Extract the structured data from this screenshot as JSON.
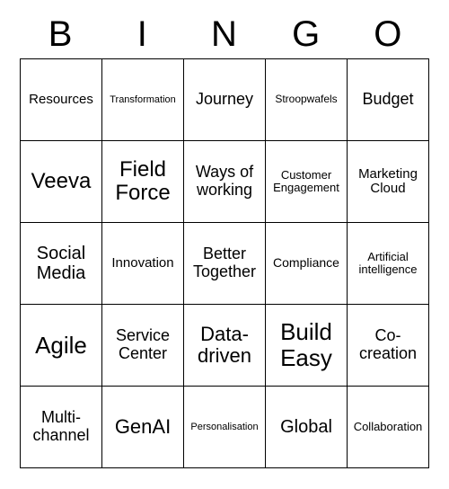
{
  "header": [
    "B",
    "I",
    "N",
    "G",
    "O"
  ],
  "cells": [
    {
      "text": "Resources",
      "size": "15px"
    },
    {
      "text": "Transformation",
      "size": "11px"
    },
    {
      "text": "Journey",
      "size": "18px"
    },
    {
      "text": "Stroopwafels",
      "size": "12px"
    },
    {
      "text": "Budget",
      "size": "18px"
    },
    {
      "text": "Veeva",
      "size": "24px"
    },
    {
      "text": "Field Force",
      "size": "24px"
    },
    {
      "text": "Ways of working",
      "size": "18px"
    },
    {
      "text": "Customer Engagement",
      "size": "13px"
    },
    {
      "text": "Marketing Cloud",
      "size": "15px"
    },
    {
      "text": "Social Media",
      "size": "20px"
    },
    {
      "text": "Innovation",
      "size": "15px"
    },
    {
      "text": "Better Together",
      "size": "18px"
    },
    {
      "text": "Compliance",
      "size": "14px"
    },
    {
      "text": "Artificial intelligence",
      "size": "13px"
    },
    {
      "text": "Agile",
      "size": "26px"
    },
    {
      "text": "Service Center",
      "size": "18px"
    },
    {
      "text": "Data-driven",
      "size": "22px"
    },
    {
      "text": "Build Easy",
      "size": "26px"
    },
    {
      "text": "Co-creation",
      "size": "18px"
    },
    {
      "text": "Multi-channel",
      "size": "18px"
    },
    {
      "text": "GenAI",
      "size": "22px"
    },
    {
      "text": "Personalisation",
      "size": "11px"
    },
    {
      "text": "Global",
      "size": "20px"
    },
    {
      "text": "Collaboration",
      "size": "13px"
    }
  ]
}
